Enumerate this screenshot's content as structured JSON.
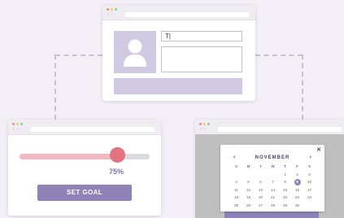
{
  "colors": {
    "background": "#f3eff6",
    "accent_purple": "#8d83b6",
    "light_purple": "#d1c8e1",
    "slider_thumb": "#e27380",
    "slider_fill": "#f1b9c0",
    "overlay_grey": "#bfbfbf",
    "dot_red": "#f08c8c",
    "dot_yellow": "#f5cc6e",
    "dot_green": "#8fd18a"
  },
  "icons": {
    "avatar": "user-icon",
    "close": "close-icon",
    "prev": "chevron-left-icon",
    "next": "chevron-right-icon"
  },
  "profile_form": {
    "text_input_value": "T|"
  },
  "goal_widget": {
    "progress": 0.75,
    "percent_label": "75%",
    "button_label": "SET GOAL"
  },
  "calendar": {
    "month": "NOVEMBER",
    "prev_symbol": "‹",
    "next_symbol": "›",
    "close_symbol": "✕",
    "weekdays": [
      "S",
      "M",
      "T",
      "W",
      "T",
      "F",
      "S"
    ],
    "selected_day": "9",
    "weeks": [
      [
        "",
        "",
        "",
        "",
        "1",
        "2",
        "3"
      ],
      [
        "4",
        "5",
        "6",
        "7",
        "8",
        "9",
        "10"
      ],
      [
        "11",
        "12",
        "13",
        "14",
        "15",
        "16",
        "17"
      ],
      [
        "18",
        "19",
        "20",
        "21",
        "22",
        "23",
        "24"
      ],
      [
        "25",
        "26",
        "27",
        "28",
        "29",
        "30",
        ""
      ]
    ]
  }
}
